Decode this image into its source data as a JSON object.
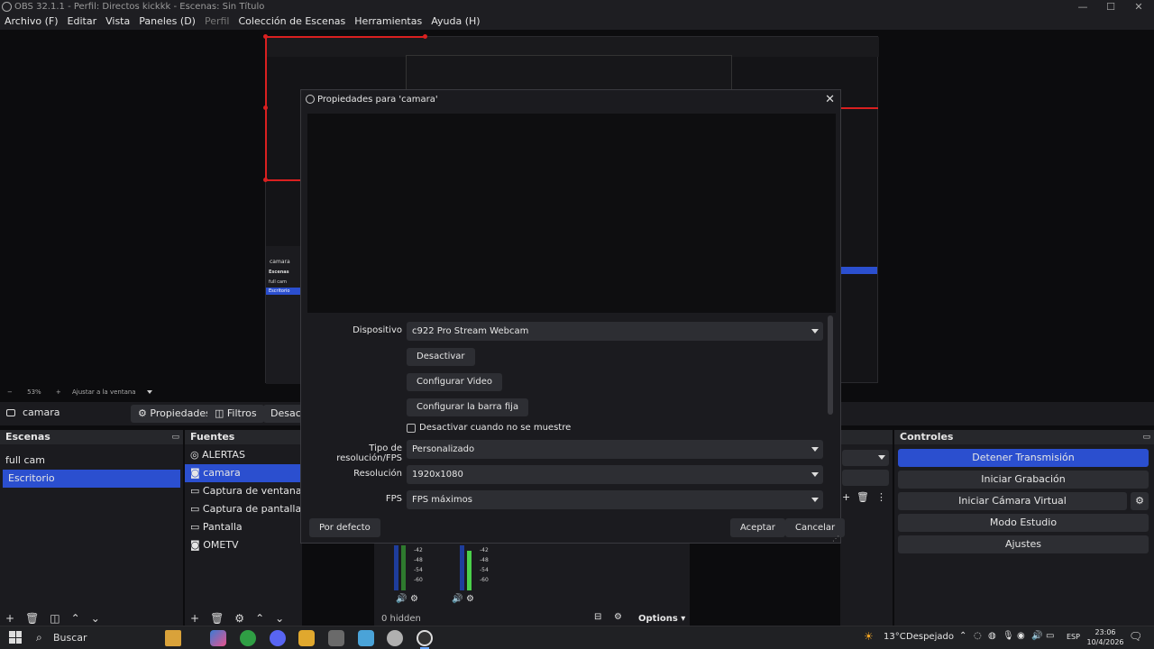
{
  "window": {
    "title": "OBS 32.1.1 - Perfil: Directos kickkk - Escenas: Sin Título",
    "min": "—",
    "max": "☐",
    "close": "✕"
  },
  "menu": [
    "Archivo (F)",
    "Editar",
    "Vista",
    "Paneles (D)",
    "Perfil",
    "Colección de Escenas",
    "Herramientas",
    "Ayuda (H)"
  ],
  "preview": {
    "zoom_minus": "−",
    "zoom": "53%",
    "zoom_plus": "+",
    "fit": "Ajustar a la ventana",
    "inner_scene_header": "camara",
    "inner_scenes_title": "Escenas",
    "inner_scene_items": [
      "full cam",
      "Escritorio"
    ]
  },
  "source_toolbar": {
    "source": "camara",
    "properties": "Propiedades",
    "filters": "Filtros",
    "deactivate": "Desacti"
  },
  "scenes": {
    "title": "Escenas",
    "items": [
      "full cam",
      "Escritorio"
    ],
    "selected": 1
  },
  "sources": {
    "title": "Fuentes",
    "items": [
      "ALERTAS",
      "camara",
      "Captura de ventana",
      "Captura de pantalla",
      "Pantalla",
      "OMETV"
    ],
    "selected": 1
  },
  "mixer": {
    "db_labels": [
      "-42",
      "-48",
      "-54",
      "-60"
    ],
    "hidden": "0 hidden",
    "options": "Options"
  },
  "controls": {
    "title": "Controles",
    "buttons": [
      "Detener Transmisión",
      "Iniciar Grabación",
      "Iniciar Cámara Virtual",
      "Modo Estudio",
      "Ajustes"
    ]
  },
  "dialog": {
    "title": "Propiedades para 'camara'",
    "device_label": "Dispositivo",
    "device_value": "c922 Pro Stream Webcam",
    "btn_deactivate": "Desactivar",
    "btn_config_video": "Configurar Video",
    "btn_config_bar": "Configurar la barra fija",
    "chk_label": "Desactivar cuando no se muestre",
    "res_type_label": "Tipo de resolución/FPS",
    "res_type_value": "Personalizado",
    "res_label": "Resolución",
    "res_value": "1920x1080",
    "fps_label": "FPS",
    "fps_value": "FPS máximos",
    "defaults": "Por defecto",
    "accept": "Aceptar",
    "cancel": "Cancelar"
  },
  "taskbar": {
    "search": "Buscar",
    "weather": "13°C",
    "weather_text": "Despejado",
    "lang": "ESP",
    "time": "23:06",
    "date": "10/4/2026"
  }
}
